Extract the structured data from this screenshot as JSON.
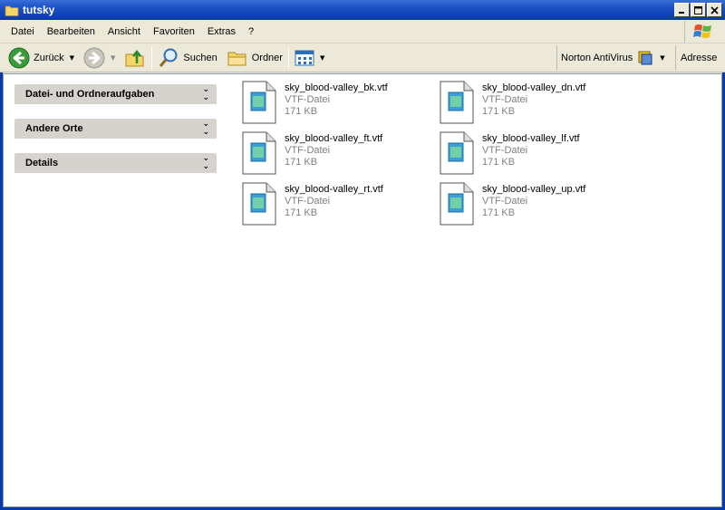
{
  "window": {
    "title": "tutsky"
  },
  "menu": [
    "Datei",
    "Bearbeiten",
    "Ansicht",
    "Favoriten",
    "Extras",
    "?"
  ],
  "toolbar": {
    "back_label": "Zurück",
    "search_label": "Suchen",
    "folders_label": "Ordner",
    "norton_label": "Norton AntiVirus",
    "address_label": "Adresse"
  },
  "task_pane": {
    "groups": [
      {
        "title": "Datei- und Ordneraufgaben"
      },
      {
        "title": "Andere Orte"
      },
      {
        "title": "Details"
      }
    ]
  },
  "files": [
    {
      "name": "sky_blood-valley_bk.vtf",
      "type": "VTF-Datei",
      "size": "171 KB"
    },
    {
      "name": "sky_blood-valley_dn.vtf",
      "type": "VTF-Datei",
      "size": "171 KB"
    },
    {
      "name": "sky_blood-valley_ft.vtf",
      "type": "VTF-Datei",
      "size": "171 KB"
    },
    {
      "name": "sky_blood-valley_lf.vtf",
      "type": "VTF-Datei",
      "size": "171 KB"
    },
    {
      "name": "sky_blood-valley_rt.vtf",
      "type": "VTF-Datei",
      "size": "171 KB"
    },
    {
      "name": "sky_blood-valley_up.vtf",
      "type": "VTF-Datei",
      "size": "171 KB"
    }
  ],
  "colors": {
    "titlebar": "#0a3aa8",
    "chrome": "#ece9d8",
    "taskgroup": "#d6d3ce"
  }
}
